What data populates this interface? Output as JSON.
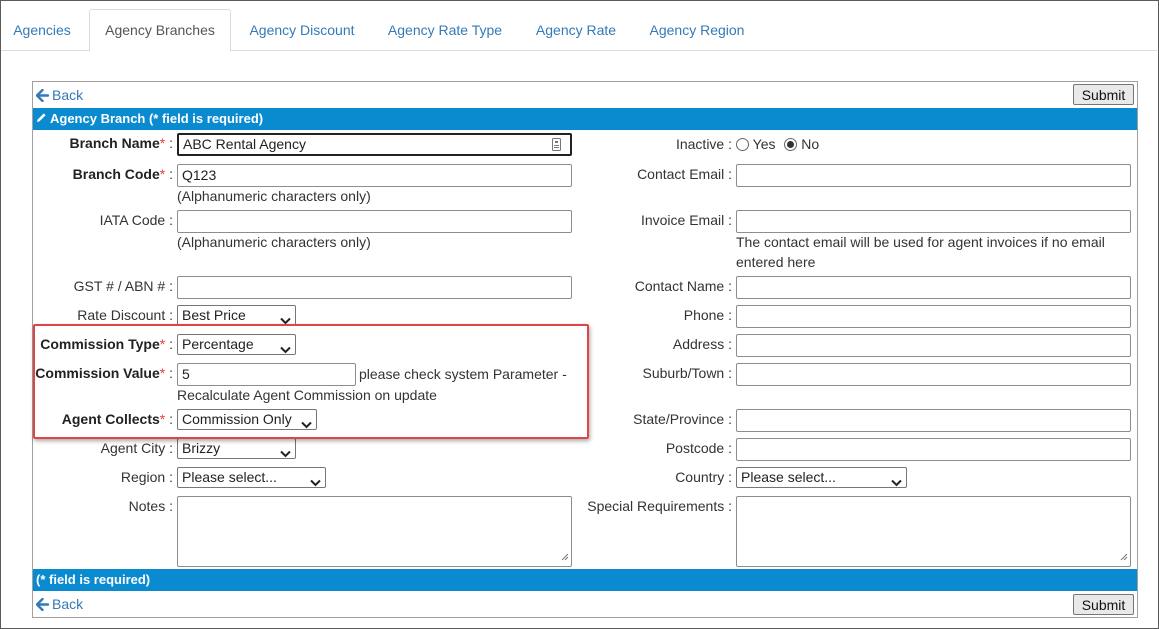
{
  "tabs": [
    {
      "label": "Agencies"
    },
    {
      "label": "Agency Branches"
    },
    {
      "label": "Agency Discount"
    },
    {
      "label": "Agency Rate Type"
    },
    {
      "label": "Agency Rate"
    },
    {
      "label": "Agency Region"
    }
  ],
  "nav": {
    "back_label": "Back",
    "submit_label": "Submit"
  },
  "header": {
    "title": "Agency Branch (* field is required)"
  },
  "footer": {
    "note": "(* field is required)"
  },
  "left": {
    "branch_name": {
      "label": "Branch Name",
      "value": "ABC Rental Agency"
    },
    "branch_code": {
      "label": "Branch Code",
      "value": "Q123",
      "hint": "(Alphanumeric characters only)"
    },
    "iata_code": {
      "label": "IATA Code",
      "value": "",
      "hint": "(Alphanumeric characters only)"
    },
    "gst_abn": {
      "label": "GST # / ABN #",
      "value": ""
    },
    "rate_discount": {
      "label": "Rate Discount",
      "value": "Best Price"
    },
    "commission_type": {
      "label": "Commission Type",
      "value": "Percentage"
    },
    "commission_value": {
      "label": "Commission Value",
      "value": "5",
      "hint_line1": "please check system Parameter -",
      "hint_line2": "Recalculate Agent Commission on update"
    },
    "agent_collects": {
      "label": "Agent Collects",
      "value": "Commission Only"
    },
    "agent_city": {
      "label": "Agent City",
      "value": "Brizzy"
    },
    "region": {
      "label": "Region",
      "value": "Please select..."
    },
    "notes": {
      "label": "Notes",
      "value": ""
    }
  },
  "right": {
    "inactive": {
      "label": "Inactive",
      "yes_label": "Yes",
      "no_label": "No",
      "selected": "No"
    },
    "contact_email": {
      "label": "Contact Email",
      "value": ""
    },
    "invoice_email": {
      "label": "Invoice Email",
      "value": "",
      "hint_line1": "The contact email will be used for agent invoices if no email",
      "hint_line2": "entered here"
    },
    "contact_name": {
      "label": "Contact Name",
      "value": ""
    },
    "phone": {
      "label": "Phone",
      "value": ""
    },
    "address": {
      "label": "Address",
      "value": ""
    },
    "suburb": {
      "label": "Suburb/Town",
      "value": ""
    },
    "state": {
      "label": "State/Province",
      "value": ""
    },
    "postcode": {
      "label": "Postcode",
      "value": ""
    },
    "country": {
      "label": "Country",
      "value": "Please select..."
    },
    "special_requirements": {
      "label": "Special Requirements",
      "value": ""
    }
  },
  "colors": {
    "accent_bar": "#0a8bd0",
    "link": "#337ab7",
    "required": "#e34141",
    "highlight_box": "#e04545"
  },
  "icons": [
    "back-arrow-icon",
    "pencil-icon",
    "field-menu-icon",
    "chevron-down-icon",
    "resize-grip-icon"
  ]
}
